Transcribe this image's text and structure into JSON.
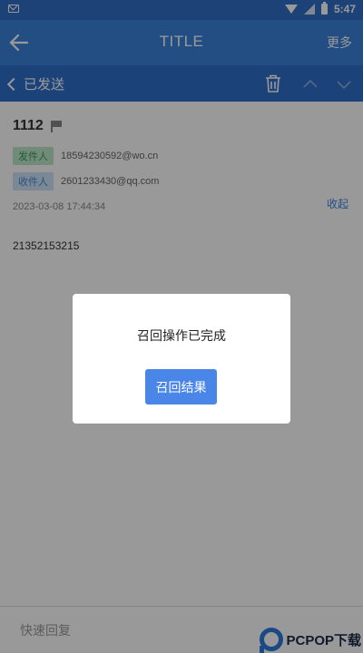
{
  "status_bar": {
    "time": "5:47",
    "icons": [
      "mail-icon",
      "wifi-icon",
      "signal-icon",
      "battery-icon"
    ]
  },
  "header": {
    "title": "TITLE",
    "more_label": "更多"
  },
  "toolbar": {
    "back_label": "已发送"
  },
  "mail": {
    "subject": "1112",
    "sender_tag": "发件人",
    "sender": "18594230592@wo.cn",
    "recipient_tag": "收件人",
    "recipient": "2601233430@qq.com",
    "date": "2023-03-08 17:44:34",
    "collapse_label": "收起",
    "body": "21352153215"
  },
  "reply": {
    "placeholder": "快速回复"
  },
  "dialog": {
    "message": "召回操作已完成",
    "button_label": "召回结果"
  },
  "watermark": {
    "text": "PCPOP下载"
  },
  "colors": {
    "primary": "#3b82dc",
    "primary_dark": "#2f6fcb",
    "button": "#4a86e8"
  }
}
